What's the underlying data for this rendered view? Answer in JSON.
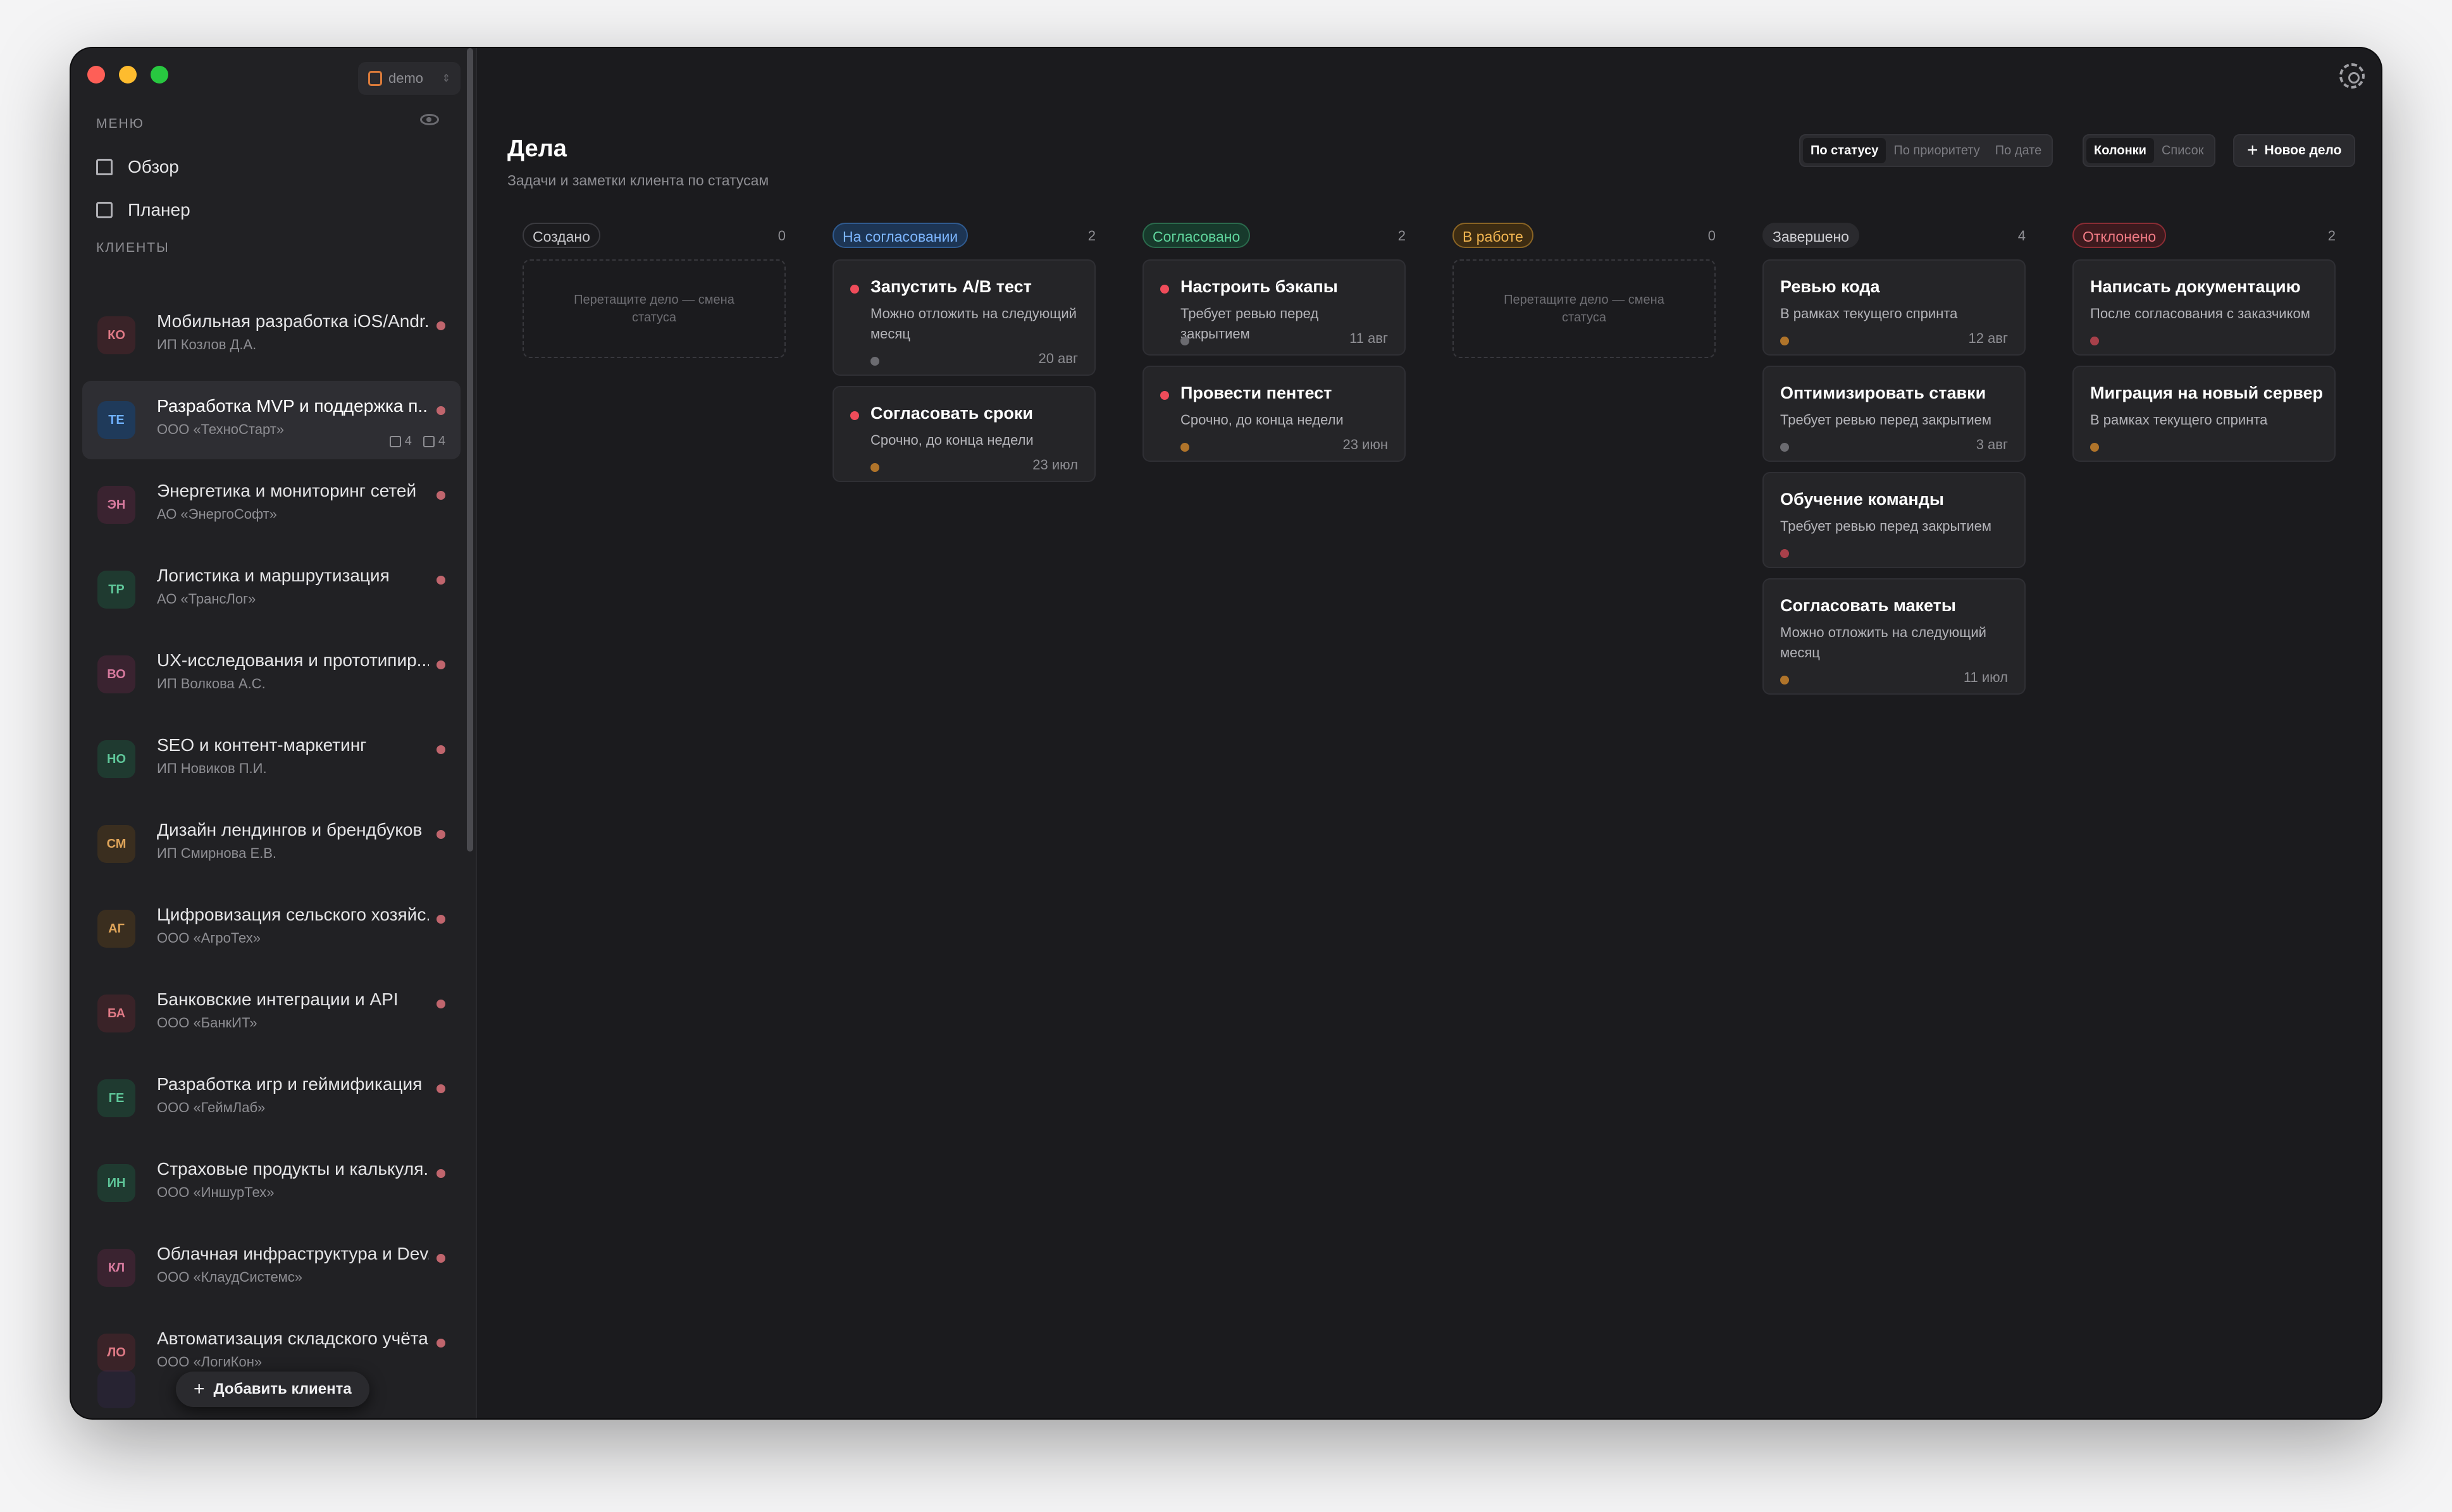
{
  "workspace": {
    "name": "demo"
  },
  "sidebar": {
    "menu_label": "МЕНЮ",
    "nav": [
      {
        "label": "Обзор"
      },
      {
        "label": "Планер"
      }
    ],
    "clients_label": "КЛИЕНТЫ",
    "clients": [
      {
        "initials": "КО",
        "title": "Мобильная разработка iOS/Andr...",
        "subtitle": "ИП Козлов Д.А.",
        "bg": "#3a2328",
        "fg": "#e07a86"
      },
      {
        "initials": "ТЕ",
        "title": "Разработка MVP и поддержка п...",
        "subtitle": "ООО «ТехноСтарт»",
        "bg": "#1f3a5a",
        "fg": "#6fb0ff",
        "stats": [
          "4",
          "4"
        ]
      },
      {
        "initials": "ЭН",
        "title": "Энергетика и мониторинг сетей",
        "subtitle": "АО «ЭнергоСофт»",
        "bg": "#3a2330",
        "fg": "#d77a9e"
      },
      {
        "initials": "ТР",
        "title": "Логистика и маршрутизация",
        "subtitle": "АО «ТрансЛог»",
        "bg": "#1f3a30",
        "fg": "#5fc79a"
      },
      {
        "initials": "ВО",
        "title": "UX-исследования и прототипир...",
        "subtitle": "ИП Волкова А.С.",
        "bg": "#3a2330",
        "fg": "#d77a9e"
      },
      {
        "initials": "НО",
        "title": "SEO и контент-маркетинг",
        "subtitle": "ИП Новиков П.И.",
        "bg": "#1f3a30",
        "fg": "#5fc79a"
      },
      {
        "initials": "СМ",
        "title": "Дизайн лендингов и брендбуков",
        "subtitle": "ИП Смирнова Е.В.",
        "bg": "#3a2e1f",
        "fg": "#e0a55a"
      },
      {
        "initials": "АГ",
        "title": "Цифровизация сельского хозяйс...",
        "subtitle": "ООО «АгроТех»",
        "bg": "#3a2e1f",
        "fg": "#e0a55a"
      },
      {
        "initials": "БА",
        "title": "Банковские интеграции и API",
        "subtitle": "ООО «БанкИТ»",
        "bg": "#3a2328",
        "fg": "#e07a86"
      },
      {
        "initials": "ГЕ",
        "title": "Разработка игр и геймификация",
        "subtitle": "ООО «ГеймЛаб»",
        "bg": "#1f3a30",
        "fg": "#5fc79a"
      },
      {
        "initials": "ИН",
        "title": "Страховые продукты и калькуля...",
        "subtitle": "ООО «ИншурТех»",
        "bg": "#1f3a30",
        "fg": "#5fc79a"
      },
      {
        "initials": "КЛ",
        "title": "Облачная инфраструктура и Dev...",
        "subtitle": "ООО «КлаудСистемс»",
        "bg": "#3a2330",
        "fg": "#d77a9e"
      },
      {
        "initials": "ЛО",
        "title": "Автоматизация складского учёта",
        "subtitle": "ООО «ЛогиКон»",
        "bg": "#3a2328",
        "fg": "#e07a86"
      }
    ],
    "add_client": "Добавить клиента"
  },
  "header": {
    "title": "Дела",
    "subtitle": "Задачи и заметки клиента по статусам",
    "group_options": [
      "По статусу",
      "По приоритету",
      "По дате"
    ],
    "view_options": [
      "Колонки",
      "Список"
    ],
    "new_button": "Новое дело"
  },
  "board": {
    "drop_hint": "Перетащите дело — смена статуса",
    "columns": [
      {
        "label": "Создано",
        "count": "0",
        "chip_bg": "transparent",
        "chip_border": "#3a3a3f",
        "chip_fg": "#c8c8cc",
        "cards": []
      },
      {
        "label": "На согласовании",
        "count": "2",
        "chip_bg": "#1d3554",
        "chip_border": "#2f5a8f",
        "chip_fg": "#7db6ff",
        "cards": [
          {
            "title": "Запустить A/B тест",
            "desc": "Можно отложить на следующий месяц",
            "date": "20 авг",
            "priority": true,
            "tag_color": "#6b6b70"
          },
          {
            "title": "Согласовать сроки",
            "desc": "Срочно, до конца недели",
            "date": "23 июл",
            "priority": true,
            "tag_color": "#b0742a"
          }
        ]
      },
      {
        "label": "Согласовано",
        "count": "2",
        "chip_bg": "#173a2c",
        "chip_border": "#2a6a4c",
        "chip_fg": "#5fd49c",
        "cards": [
          {
            "title": "Настроить бэкапы",
            "desc": "Требует ревью перед закрытием",
            "date": "11 авг",
            "priority": true,
            "tag_color": "#6b6b70"
          },
          {
            "title": "Провести пентест",
            "desc": "Срочно, до конца недели",
            "date": "23 июн",
            "priority": true,
            "tag_color": "#b0742a"
          }
        ]
      },
      {
        "label": "В работе",
        "count": "0",
        "chip_bg": "#3d2c12",
        "chip_border": "#8a6424",
        "chip_fg": "#f0b450",
        "cards": []
      },
      {
        "label": "Завершено",
        "count": "4",
        "chip_bg": "#2a2a2e",
        "chip_border": "#2a2a2e",
        "chip_fg": "#d0d0d4",
        "cards": [
          {
            "title": "Ревью кода",
            "desc": "В рамках текущего спринта",
            "date": "12 авг",
            "priority": false,
            "tag_color": "#b0742a"
          },
          {
            "title": "Оптимизировать ставки",
            "desc": "Требует ревью перед закрытием",
            "date": "3 авг",
            "priority": false,
            "tag_color": "#6b6b70"
          },
          {
            "title": "Обучение команды",
            "desc": "Требует ревью перед закрытием",
            "date": "",
            "priority": false,
            "tag_color": "#a8404a"
          },
          {
            "title": "Согласовать макеты",
            "desc": "Можно отложить на следующий месяц",
            "date": "11 июл",
            "priority": false,
            "tag_color": "#b0742a"
          }
        ]
      },
      {
        "label": "Отклонено",
        "count": "2",
        "chip_bg": "#3d1a1e",
        "chip_border": "#8a2c34",
        "chip_fg": "#f07a84",
        "cards": [
          {
            "title": "Написать документацию",
            "desc": "После согласования с заказчиком",
            "date": "",
            "priority": false,
            "tag_color": "#a8404a"
          },
          {
            "title": "Миграция на новый сервер",
            "desc": "В рамках текущего спринта",
            "date": "",
            "priority": false,
            "tag_color": "#b0742a"
          }
        ]
      }
    ]
  }
}
